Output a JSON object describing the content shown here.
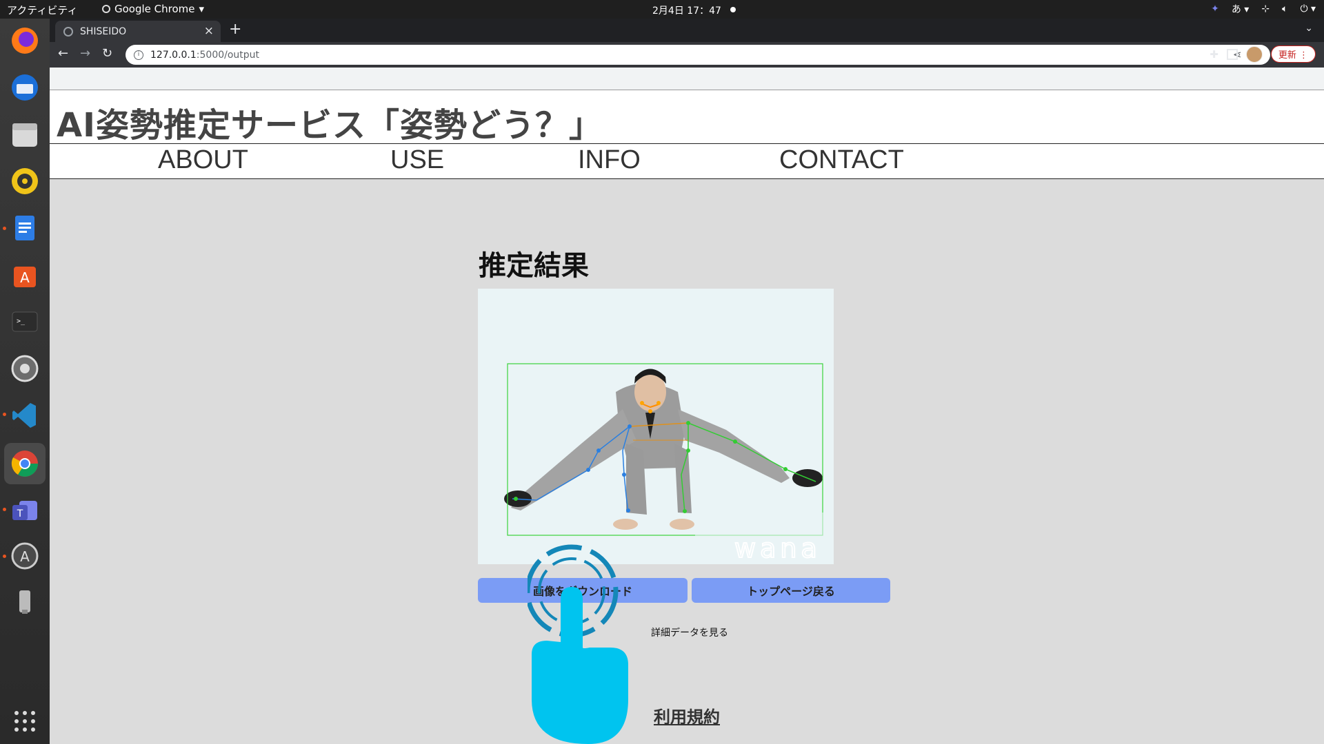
{
  "topbar": {
    "activities": "アクティビティ",
    "app_name": "Google Chrome",
    "clock": "2月4日  17：47",
    "input_method": "あ"
  },
  "browser": {
    "tab_title": "SHISEIDO",
    "url_host": "127.0.0.1",
    "url_path": ":5000/output",
    "update_label": "更新"
  },
  "site": {
    "title": "AI姿勢推定サービス「姿勢どう？」",
    "nav": [
      "ABOUT",
      "USE",
      "INFO",
      "CONTACT"
    ]
  },
  "main": {
    "heading": "推定結果",
    "download_button": "画像をダウンロード",
    "top_button": "トップページ戻る",
    "detail_link": "詳細データを見る",
    "terms_link": "利用規約",
    "image_watermark": "wana"
  },
  "colors": {
    "button_blue": "#7b9cf5",
    "page_bg": "#dcdcdc",
    "pointer_cyan": "#00c4ef",
    "bbox_green": "#3bd23b"
  }
}
